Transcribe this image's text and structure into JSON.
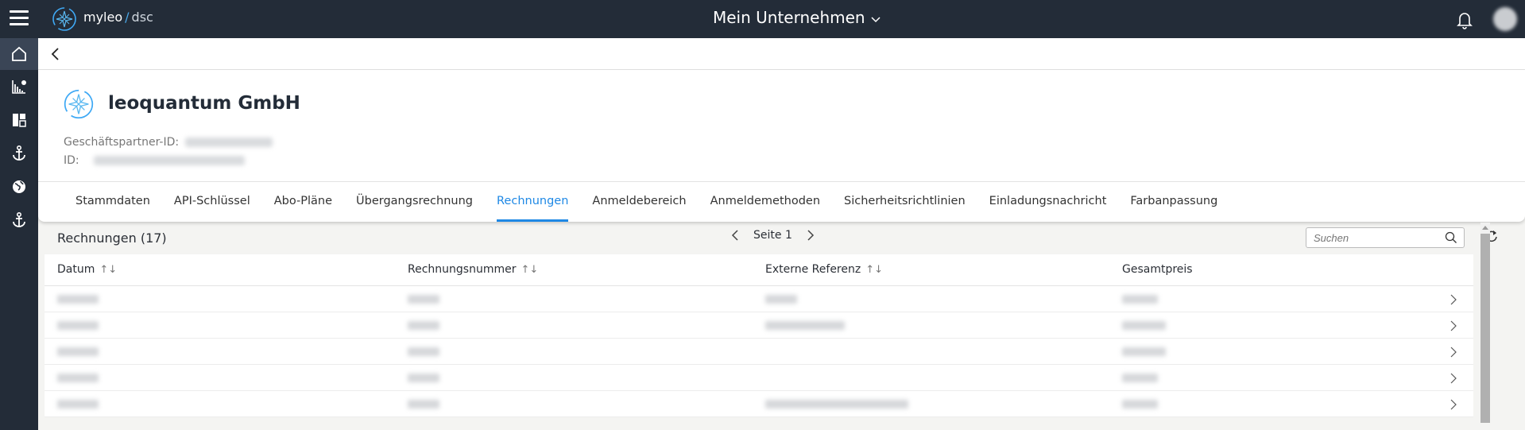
{
  "topbar": {
    "brand_name": "myleo",
    "brand_sep": "/",
    "brand_suffix": "dsc",
    "company": "Mein Unternehmen"
  },
  "sidebar": {
    "items": [
      {
        "icon": "home-icon"
      },
      {
        "icon": "analytics-icon"
      },
      {
        "icon": "dashboard-icon"
      },
      {
        "icon": "anchor-icon"
      },
      {
        "icon": "globe-icon"
      },
      {
        "icon": "anchor-icon"
      }
    ]
  },
  "partner": {
    "name": "leoquantum GmbH",
    "partner_id_label": "Geschäftspartner-ID:",
    "id_label": "ID:"
  },
  "tabs": [
    "Stammdaten",
    "API-Schlüssel",
    "Abo-Pläne",
    "Übergangsrechnung",
    "Rechnungen",
    "Anmeldebereich",
    "Anmeldemethoden",
    "Sicherheitsrichtlinien",
    "Einladungsnachricht",
    "Farbanpassung"
  ],
  "active_tab": "Rechnungen",
  "invoices": {
    "title": "Rechnungen (17)",
    "page": "Seite 1",
    "search_placeholder": "Suchen",
    "columns": [
      "Datum",
      "Rechnungsnummer",
      "Externe Referenz",
      "Gesamtpreis"
    ],
    "sort_icon": "↑↓",
    "row_count_visible": 5
  },
  "colors": {
    "accent": "#1e88e5",
    "topbar": "#232c38"
  }
}
